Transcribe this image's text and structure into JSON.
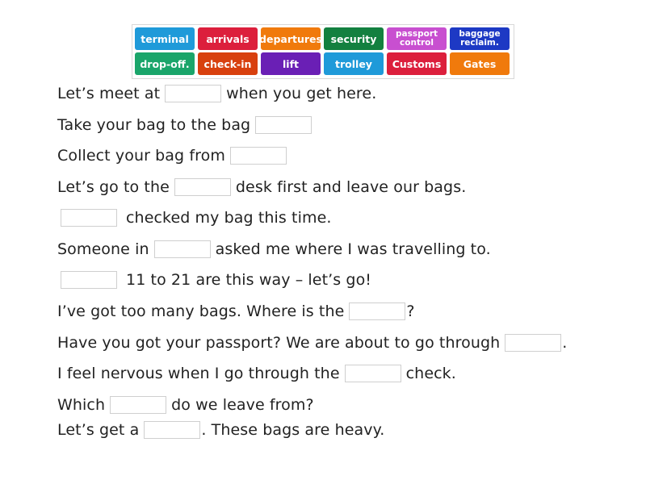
{
  "word_bank": {
    "tiles": [
      {
        "label": "terminal",
        "color": "#1f9ad9"
      },
      {
        "label": "arrivals",
        "color": "#dc1f3c"
      },
      {
        "label": "departures",
        "color": "#f07a0c"
      },
      {
        "label": "security",
        "color": "#13803f"
      },
      {
        "label": "passport control",
        "color": "#c84fd0"
      },
      {
        "label": "baggage reclaim.",
        "color": "#1d39c4"
      },
      {
        "label": "drop-off.",
        "color": "#1aa56a"
      },
      {
        "label": "check-in",
        "color": "#d8400e"
      },
      {
        "label": "lift",
        "color": "#6a1fb5"
      },
      {
        "label": "trolley",
        "color": "#1f9ad9"
      },
      {
        "label": "Customs",
        "color": "#dc1f3c"
      },
      {
        "label": "Gates",
        "color": "#f07a0c"
      }
    ]
  },
  "sentences": [
    {
      "before": "Let’s meet at",
      "after": "when you get here."
    },
    {
      "before": "Take your bag to the bag",
      "after": ""
    },
    {
      "before": "Collect your bag from",
      "after": ""
    },
    {
      "before": "Let’s go to the",
      "after": "desk first and leave our bags."
    },
    {
      "before": "",
      "after": "checked my bag this time."
    },
    {
      "before": "Someone in",
      "after": "asked me where I was travelling to."
    },
    {
      "before": "",
      "after": "11 to 21 are this way – let’s go!"
    },
    {
      "before": "I’ve got too many bags. Where is the",
      "after": "?"
    },
    {
      "before": "Have you got your passport? We are about to go through",
      "after": "."
    },
    {
      "before": "I feel nervous when I go through the",
      "after": "check."
    },
    {
      "before": "Which",
      "after": "do we leave from?"
    },
    {
      "before": "Let’s get a",
      "after": ". These bags are heavy."
    }
  ]
}
